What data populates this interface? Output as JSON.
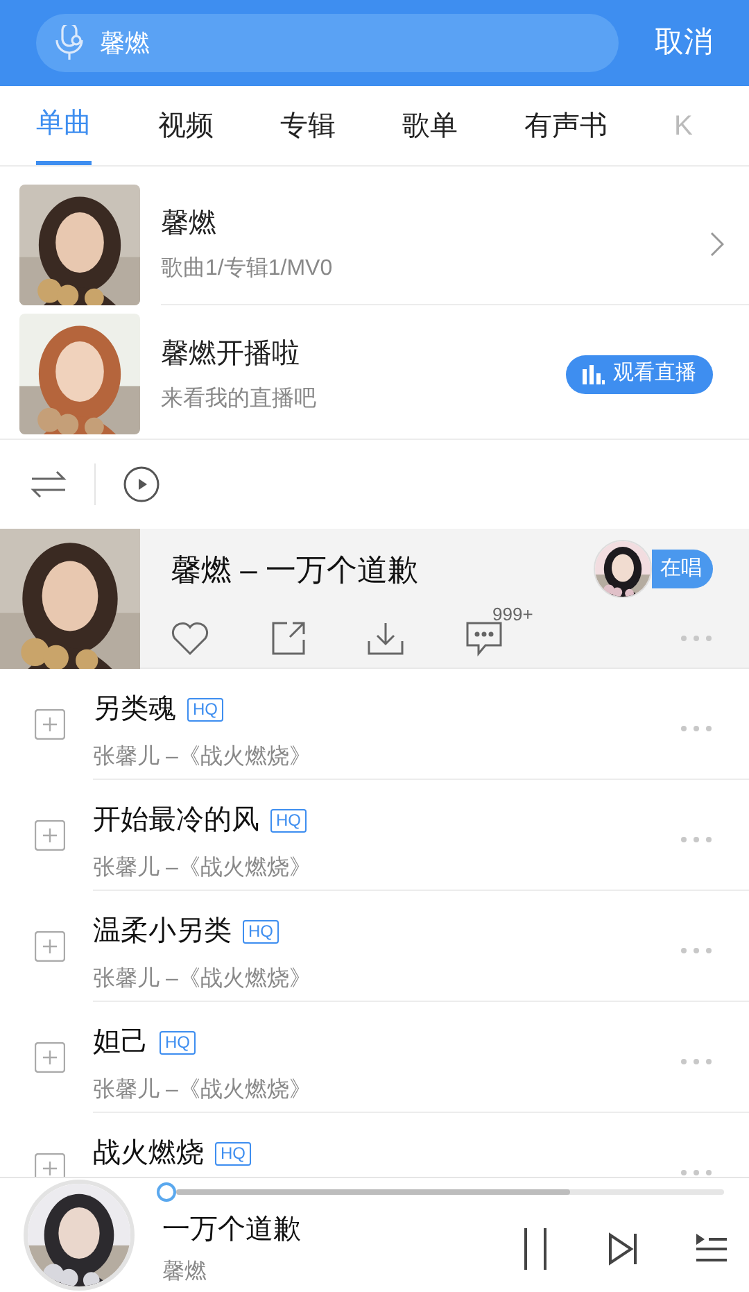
{
  "search": {
    "value": "馨燃",
    "cancel": "取消"
  },
  "tabs": [
    {
      "label": "单曲",
      "selected": true
    },
    {
      "label": "视频",
      "selected": false
    },
    {
      "label": "专辑",
      "selected": false
    },
    {
      "label": "歌单",
      "selected": false
    },
    {
      "label": "有声书",
      "selected": false
    },
    {
      "label": "K",
      "selected": false
    }
  ],
  "artist": {
    "name": "馨燃",
    "stats": "歌曲1/专辑1/MV0"
  },
  "live": {
    "title": "馨燃开播啦",
    "subtitle": "来看我的直播吧",
    "button": "观看直播"
  },
  "current_song": {
    "title": "馨燃 – 一万个道歉",
    "singing_badge": "在唱",
    "comment_count": "999+"
  },
  "songs": [
    {
      "title": "另类魂",
      "badge": "HQ",
      "subtitle": "张馨儿 –《战火燃烧》"
    },
    {
      "title": "开始最冷的风",
      "badge": "HQ",
      "subtitle": "张馨儿 –《战火燃烧》"
    },
    {
      "title": "温柔小另类",
      "badge": "HQ",
      "subtitle": "张馨儿 –《战火燃烧》"
    },
    {
      "title": "妲己",
      "badge": "HQ",
      "subtitle": "张馨儿 –《战火燃烧》"
    },
    {
      "title": "战火燃烧",
      "badge": "HQ"
    }
  ],
  "player": {
    "title": "一万个道歉",
    "artist": "馨燃",
    "level": 0
  }
}
